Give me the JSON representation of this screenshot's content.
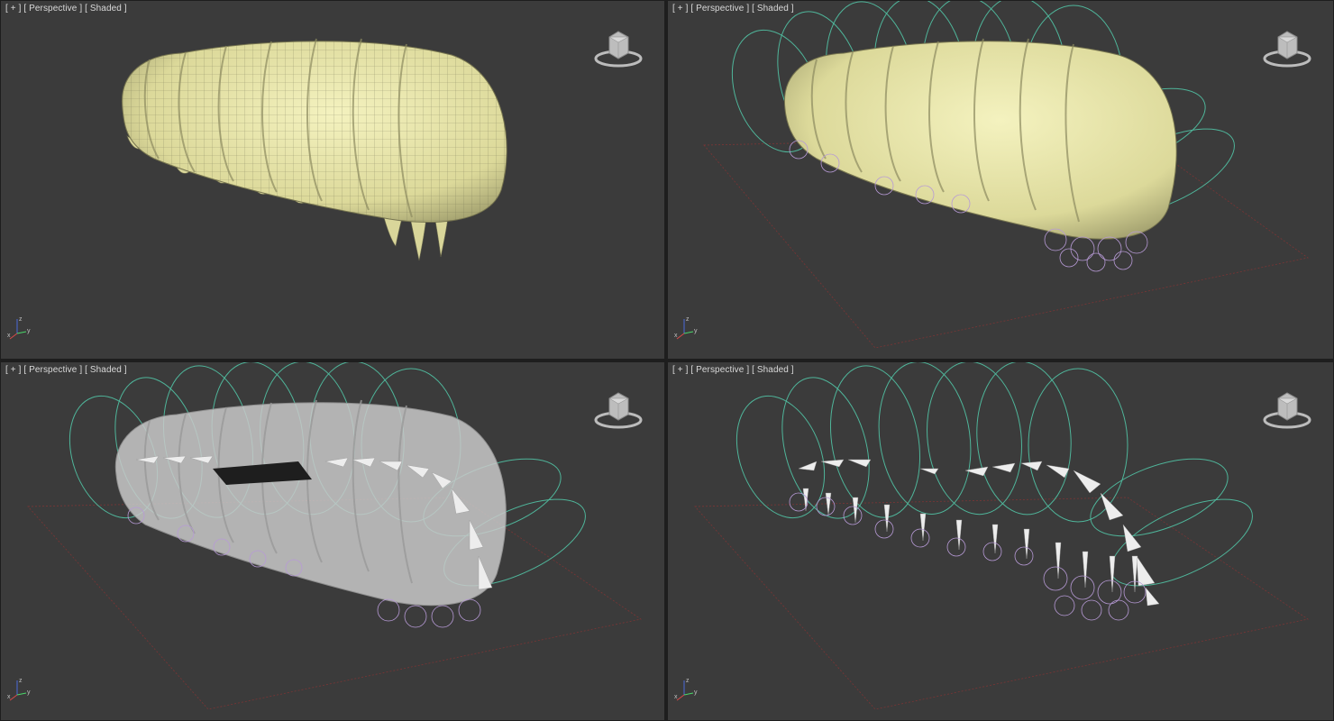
{
  "viewports": [
    {
      "menu": "[ + ]",
      "view": "[ Perspective ]",
      "shading": "[ Shaded ]"
    },
    {
      "menu": "[ + ]",
      "view": "[ Perspective ]",
      "shading": "[ Shaded ]"
    },
    {
      "menu": "[ + ]",
      "view": "[ Perspective ]",
      "shading": "[ Shaded ]"
    },
    {
      "menu": "[ + ]",
      "view": "[ Perspective ]",
      "shading": "[ Shaded ]"
    }
  ],
  "axis": {
    "x": "x",
    "y": "y",
    "z": "z"
  },
  "colors": {
    "viewport_bg": "#3b3b3b",
    "body_fill": "#e9e7a9",
    "body_wire": "#5b5b43",
    "xray_fill": "#c9c9c9",
    "control_curve": "#4fb59a",
    "ik_circle": "#b79ad6",
    "bone": "#e6e6e6",
    "grid_line": "#7a3535"
  },
  "icons": {
    "viewcube": "viewcube-icon",
    "axis": "axis-tripod-icon"
  }
}
